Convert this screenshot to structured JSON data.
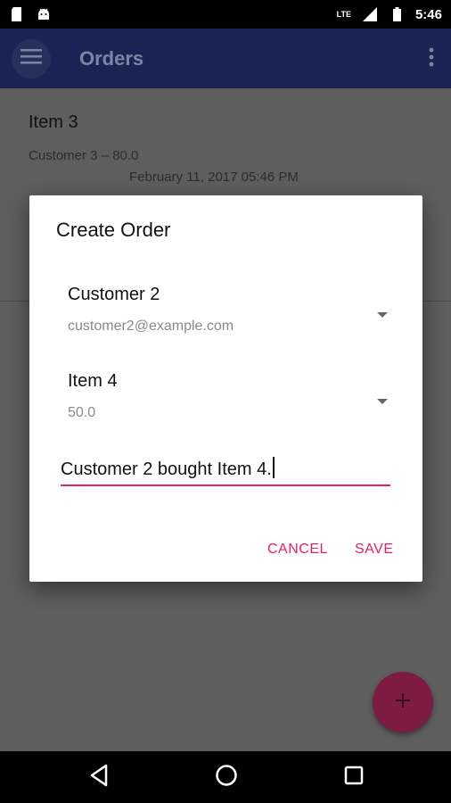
{
  "status_bar": {
    "time": "5:46",
    "network_label": "LTE",
    "icons": [
      "sd-card-icon",
      "android-icon",
      "signal-icon",
      "battery-icon"
    ]
  },
  "app_bar": {
    "title": "Orders",
    "menu_icon": "hamburger-icon",
    "overflow_icon": "more-vert-icon"
  },
  "list": {
    "items": [
      {
        "title": "Item 3",
        "subtitle": "Customer 3 – 80.0",
        "date": "February 11, 2017 05:46 PM"
      }
    ]
  },
  "dialog": {
    "title": "Create Order",
    "customer_spinner": {
      "primary": "Customer 2",
      "secondary": "customer2@example.com"
    },
    "item_spinner": {
      "primary": "Item 4",
      "secondary": "50.0"
    },
    "note_field": {
      "value": "Customer 2 bought Item 4."
    },
    "actions": {
      "cancel_label": "CANCEL",
      "save_label": "SAVE"
    }
  },
  "fab": {
    "icon": "plus-icon"
  },
  "colors": {
    "accent": "#e91e63",
    "primary": "#1a2353",
    "fab": "#7d1b43"
  }
}
